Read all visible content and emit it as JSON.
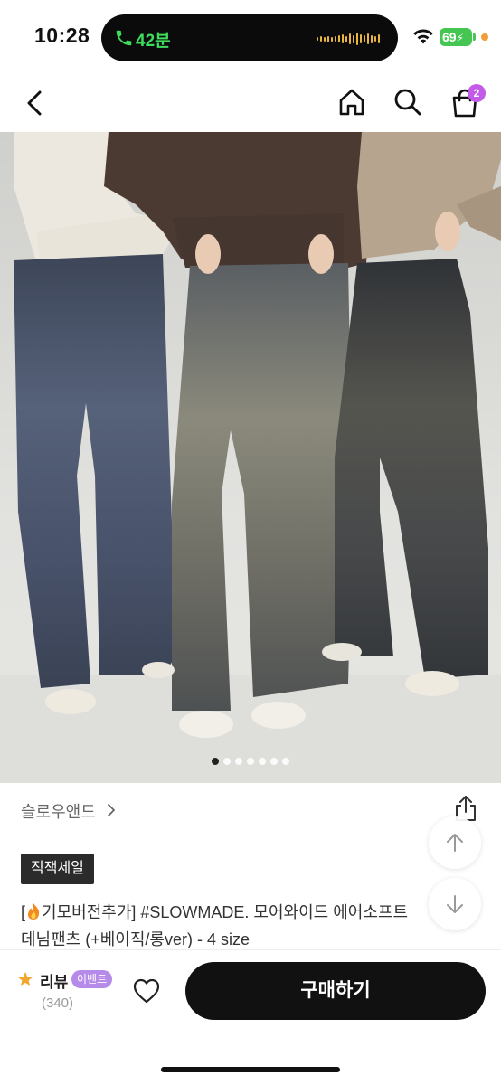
{
  "status_bar": {
    "time": "10:28",
    "call_duration": "42분",
    "battery_level": "69",
    "icons": [
      "phone-icon",
      "wifi-icon",
      "battery-icon"
    ]
  },
  "nav": {
    "icons": [
      "back-icon",
      "home-icon",
      "search-icon",
      "cart-icon"
    ],
    "cart_count": "2"
  },
  "gallery": {
    "total_images": 7,
    "active_index": 0
  },
  "product": {
    "brand": "슬로우앤드",
    "sale_badge": "직잭세일",
    "title_prefix": "[",
    "title_line1": "기모버전추가] #SLOWMADE. 모어와이드 에어소프트",
    "title_line2": "데님팬츠 (+베이직/롱ver) - 4 size"
  },
  "bottom_bar": {
    "review_label": "리뷰",
    "event_badge": "이벤트",
    "review_count": "(340)",
    "buy_label": "구매하기"
  },
  "colors": {
    "accent_purple": "#c45be8",
    "event_purple": "#b58ae8",
    "call_green": "#3ddc5c",
    "battery_green": "#45c552",
    "buy_button": "#111111"
  }
}
